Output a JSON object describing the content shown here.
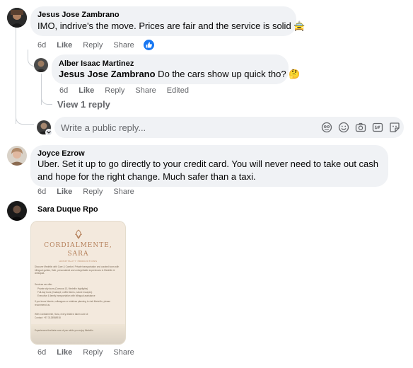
{
  "comments": [
    {
      "author": "Jesus Jose Zambrano",
      "text": "IMO, indrive's the move. Prices are fair and the service is solid 🚖",
      "meta": {
        "time": "6d",
        "like": "Like",
        "reply": "Reply",
        "share": "Share"
      }
    },
    {
      "author": "Alber Isaac Martinez",
      "mention": "Jesus Jose Zambrano",
      "text": " Do the cars show up quick tho? 🤔",
      "meta": {
        "time": "6d",
        "like": "Like",
        "reply": "Reply",
        "share": "Share",
        "edited": "Edited"
      }
    },
    {
      "author": "Joyce Ezrow",
      "text": "Uber. Set it up to go directly to your credit card. You will never need to take out cash and hope for the right change. Much safer than a taxi.",
      "meta": {
        "time": "6d",
        "like": "Like",
        "reply": "Reply",
        "share": "Share"
      }
    },
    {
      "author": "Sara Duque Rpo",
      "meta": {
        "time": "6d",
        "like": "Like",
        "reply": "Reply",
        "share": "Share"
      },
      "image": {
        "title_line1": "CORDIALMENTE,",
        "title_line2": "SARA",
        "subtitle": "HOSPITALITY PRODUCTIONS",
        "intro": "Discover Medellín with Care & Comfort. Private transportation and curated tours with bilingual guides, Safe, personalized and unforgettable experiences in Medellín & Antioquia.",
        "offer_heading": "Services we offer:",
        "offers": [
          "Private city tours (Comuna 13, Medellín highlights)",
          "Full-day tours (Guatapé, coffee farms, nature escapes)",
          "Executive & family transportation with bilingual assistance"
        ],
        "referral": "If you know friends, colleagues or relatives planning to visit Medellín, please recommend us.",
        "signoff": "With Cordialmente, Sara, every detail is taken care of.",
        "contact": "Contact: +57 3128588918",
        "footer": "Experiences that take care of you while you enjoy Medellín"
      }
    }
  ],
  "view_replies": "View 1 reply",
  "reply_box": {
    "placeholder": "Write a public reply..."
  },
  "colors": {
    "bubble": "#f0f2f5",
    "meta": "#65676b",
    "like_blue": "#1877f2",
    "thread": "#ccd0d5"
  }
}
